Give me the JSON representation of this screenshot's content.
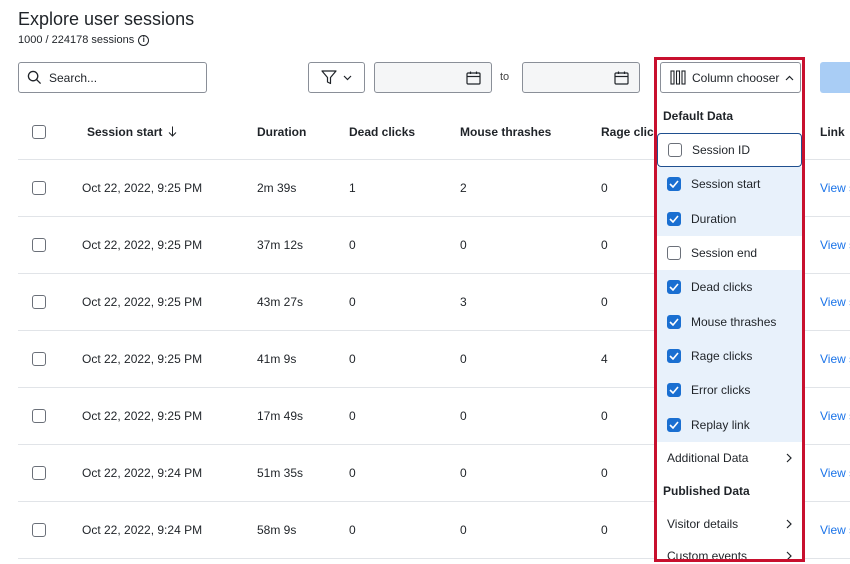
{
  "header": {
    "title": "Explore user sessions",
    "subtitle": "1000 / 224178 sessions"
  },
  "toolbar": {
    "search_placeholder": "Search...",
    "to_label": "to",
    "column_chooser_label": "Column chooser"
  },
  "table": {
    "columns": {
      "session_start": "Session start",
      "duration": "Duration",
      "dead_clicks": "Dead clicks",
      "mouse_thrashes": "Mouse thrashes",
      "rage_clicks": "Rage click",
      "link": "Link"
    },
    "rows": [
      {
        "start": "Oct 22, 2022, 9:25 PM",
        "duration": "2m 39s",
        "dead": "1",
        "mouse": "2",
        "rage": "0",
        "link": "View s"
      },
      {
        "start": "Oct 22, 2022, 9:25 PM",
        "duration": "37m 12s",
        "dead": "0",
        "mouse": "0",
        "rage": "0",
        "link": "View s"
      },
      {
        "start": "Oct 22, 2022, 9:25 PM",
        "duration": "43m 27s",
        "dead": "0",
        "mouse": "3",
        "rage": "0",
        "link": "View s"
      },
      {
        "start": "Oct 22, 2022, 9:25 PM",
        "duration": "41m 9s",
        "dead": "0",
        "mouse": "0",
        "rage": "4",
        "link": "View s"
      },
      {
        "start": "Oct 22, 2022, 9:25 PM",
        "duration": "17m 49s",
        "dead": "0",
        "mouse": "0",
        "rage": "0",
        "link": "View s"
      },
      {
        "start": "Oct 22, 2022, 9:24 PM",
        "duration": "51m 35s",
        "dead": "0",
        "mouse": "0",
        "rage": "0",
        "link": "View s"
      },
      {
        "start": "Oct 22, 2022, 9:24 PM",
        "duration": "58m 9s",
        "dead": "0",
        "mouse": "0",
        "rage": "0",
        "link": "View s"
      }
    ]
  },
  "column_chooser": {
    "default_section": "Default Data",
    "options": [
      {
        "label": "Session ID",
        "checked": false,
        "focused": true
      },
      {
        "label": "Session start",
        "checked": true
      },
      {
        "label": "Duration",
        "checked": true
      },
      {
        "label": "Session end",
        "checked": false
      },
      {
        "label": "Dead clicks",
        "checked": true
      },
      {
        "label": "Mouse thrashes",
        "checked": true
      },
      {
        "label": "Rage clicks",
        "checked": true
      },
      {
        "label": "Error clicks",
        "checked": true
      },
      {
        "label": "Replay link",
        "checked": true
      }
    ],
    "additional_data": "Additional Data",
    "published_section": "Published Data",
    "visitor_details": "Visitor details",
    "custom_events": "Custom events"
  },
  "colors": {
    "accent": "#1a6fd1",
    "highlight": "#c8102e",
    "link": "#1a73e8"
  }
}
